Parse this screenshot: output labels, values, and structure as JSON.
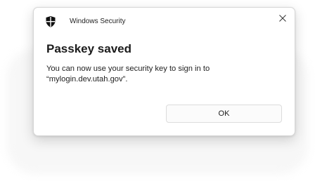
{
  "window": {
    "app_title": "Windows Security",
    "app_icon": "shield-icon",
    "close_icon": "close-icon"
  },
  "dialog": {
    "heading": "Passkey saved",
    "message_line1": "You can now use your security key to sign in to",
    "message_line2": "“mylogin.dev.utah.gov”.",
    "ok_label": "OK"
  }
}
